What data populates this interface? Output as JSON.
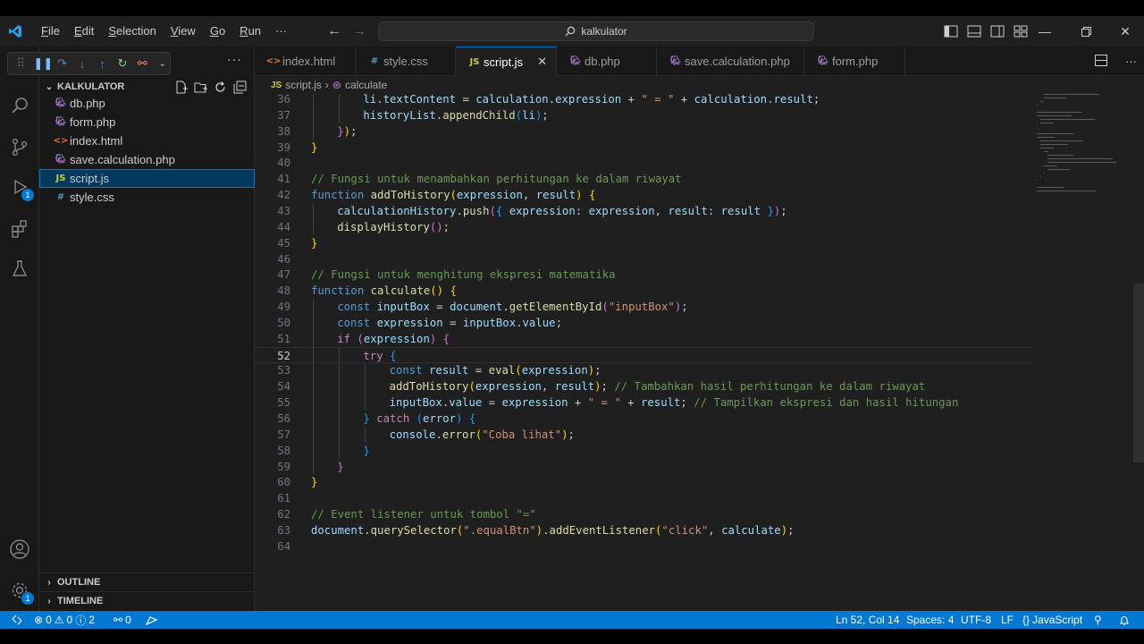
{
  "titlebar": {
    "menu": [
      "File",
      "Edit",
      "Selection",
      "View",
      "Go",
      "Run"
    ],
    "menu_underline": [
      "F",
      "E",
      "S",
      "V",
      "G",
      "R"
    ],
    "menu_rest": [
      "ile",
      "dit",
      "election",
      "iew",
      "o",
      "un"
    ],
    "more": "···",
    "search_text": "kalkulator"
  },
  "explorer": {
    "title": "KALKULATOR",
    "files": [
      {
        "name": "db.php",
        "icon": "php-elephant-icon",
        "active": false
      },
      {
        "name": "form.php",
        "icon": "php-elephant-icon",
        "active": false
      },
      {
        "name": "index.html",
        "icon": "html-icon",
        "active": false
      },
      {
        "name": "save.calculation.php",
        "icon": "php-elephant-icon",
        "active": false
      },
      {
        "name": "script.js",
        "icon": "js-icon",
        "active": true
      },
      {
        "name": "style.css",
        "icon": "css-icon",
        "active": false
      }
    ],
    "outline": "OUTLINE",
    "timeline": "TIMELINE"
  },
  "tabs": [
    {
      "label": "index.html",
      "icon": "html-icon",
      "active": false
    },
    {
      "label": "style.css",
      "icon": "css-icon",
      "active": false
    },
    {
      "label": "script.js",
      "icon": "js-icon",
      "active": true
    },
    {
      "label": "db.php",
      "icon": "php-elephant-icon",
      "active": false
    },
    {
      "label": "save.calculation.php",
      "icon": "php-elephant-icon",
      "active": false
    },
    {
      "label": "form.php",
      "icon": "php-elephant-icon",
      "active": false
    }
  ],
  "breadcrumb": {
    "file": "script.js",
    "symbol": "calculate"
  },
  "editor": {
    "current_line": 52,
    "lines": [
      {
        "n": 36,
        "indent": 2,
        "tokens": [
          [
            "vr",
            "li"
          ],
          [
            "",
            "."
          ],
          [
            "vr",
            "textContent"
          ],
          [
            "",
            " = "
          ],
          [
            "vr",
            "calculation"
          ],
          [
            "",
            "."
          ],
          [
            "vr",
            "expression"
          ],
          [
            "",
            " + "
          ],
          [
            "str",
            "\" = \""
          ],
          [
            "",
            " + "
          ],
          [
            "vr",
            "calculation"
          ],
          [
            "",
            "."
          ],
          [
            "vr",
            "result"
          ],
          [
            "",
            ";"
          ]
        ]
      },
      {
        "n": 37,
        "indent": 2,
        "tokens": [
          [
            "vr",
            "historyList"
          ],
          [
            "",
            "."
          ],
          [
            "fn",
            "appendChild"
          ],
          [
            "b3",
            "("
          ],
          [
            "vr",
            "li"
          ],
          [
            "b3",
            ")"
          ],
          [
            "",
            ";"
          ]
        ]
      },
      {
        "n": 38,
        "indent": 1,
        "tokens": [
          [
            "b2",
            "}"
          ],
          [
            "b1",
            ")"
          ],
          [
            "",
            ";"
          ]
        ]
      },
      {
        "n": 39,
        "indent": 0,
        "tokens": [
          [
            "b1",
            "}"
          ]
        ]
      },
      {
        "n": 40,
        "indent": 0,
        "tokens": []
      },
      {
        "n": 41,
        "indent": 0,
        "tokens": [
          [
            "cm",
            "// Fungsi untuk menambahkan perhitungan ke dalam riwayat"
          ]
        ]
      },
      {
        "n": 42,
        "indent": 0,
        "tokens": [
          [
            "kw",
            "function"
          ],
          [
            "",
            " "
          ],
          [
            "fn",
            "addToHistory"
          ],
          [
            "b1",
            "("
          ],
          [
            "vr",
            "expression"
          ],
          [
            "",
            ", "
          ],
          [
            "vr",
            "result"
          ],
          [
            "b1",
            ")"
          ],
          [
            "",
            " "
          ],
          [
            "b1",
            "{"
          ]
        ]
      },
      {
        "n": 43,
        "indent": 1,
        "tokens": [
          [
            "vr",
            "calculationHistory"
          ],
          [
            "",
            "."
          ],
          [
            "fn",
            "push"
          ],
          [
            "b2",
            "("
          ],
          [
            "b3",
            "{"
          ],
          [
            "",
            " "
          ],
          [
            "vr",
            "expression"
          ],
          [
            "",
            ": "
          ],
          [
            "vr",
            "expression"
          ],
          [
            "",
            ", "
          ],
          [
            "vr",
            "result"
          ],
          [
            "",
            ": "
          ],
          [
            "vr",
            "result"
          ],
          [
            "",
            " "
          ],
          [
            "b3",
            "}"
          ],
          [
            "b2",
            ")"
          ],
          [
            "",
            ";"
          ]
        ]
      },
      {
        "n": 44,
        "indent": 1,
        "tokens": [
          [
            "fn",
            "displayHistory"
          ],
          [
            "b2",
            "()"
          ],
          [
            "",
            ";"
          ]
        ]
      },
      {
        "n": 45,
        "indent": 0,
        "tokens": [
          [
            "b1",
            "}"
          ]
        ]
      },
      {
        "n": 46,
        "indent": 0,
        "tokens": []
      },
      {
        "n": 47,
        "indent": 0,
        "tokens": [
          [
            "cm",
            "// Fungsi untuk menghitung ekspresi matematika"
          ]
        ]
      },
      {
        "n": 48,
        "indent": 0,
        "tokens": [
          [
            "kw",
            "function"
          ],
          [
            "",
            " "
          ],
          [
            "fn",
            "calculate"
          ],
          [
            "b1",
            "()"
          ],
          [
            "",
            " "
          ],
          [
            "b1",
            "{"
          ]
        ]
      },
      {
        "n": 49,
        "indent": 1,
        "tokens": [
          [
            "kw",
            "const"
          ],
          [
            "",
            " "
          ],
          [
            "vr",
            "inputBox"
          ],
          [
            "",
            " = "
          ],
          [
            "vr",
            "document"
          ],
          [
            "",
            "."
          ],
          [
            "fn",
            "getElementById"
          ],
          [
            "b2",
            "("
          ],
          [
            "str",
            "\"inputBox\""
          ],
          [
            "b2",
            ")"
          ],
          [
            "",
            ";"
          ]
        ]
      },
      {
        "n": 50,
        "indent": 1,
        "tokens": [
          [
            "kw",
            "const"
          ],
          [
            "",
            " "
          ],
          [
            "vr",
            "expression"
          ],
          [
            "",
            " = "
          ],
          [
            "vr",
            "inputBox"
          ],
          [
            "",
            "."
          ],
          [
            "vr",
            "value"
          ],
          [
            "",
            ";"
          ]
        ]
      },
      {
        "n": 51,
        "indent": 1,
        "tokens": [
          [
            "kc",
            "if"
          ],
          [
            "",
            " "
          ],
          [
            "b2",
            "("
          ],
          [
            "vr",
            "expression"
          ],
          [
            "b2",
            ")"
          ],
          [
            "",
            " "
          ],
          [
            "b2",
            "{"
          ]
        ]
      },
      {
        "n": 52,
        "indent": 2,
        "tokens": [
          [
            "kc",
            "try"
          ],
          [
            "",
            " "
          ],
          [
            "b3",
            "{"
          ]
        ]
      },
      {
        "n": 53,
        "indent": 3,
        "tokens": [
          [
            "kw",
            "const"
          ],
          [
            "",
            " "
          ],
          [
            "vr",
            "result"
          ],
          [
            "",
            " = "
          ],
          [
            "fn",
            "eval"
          ],
          [
            "b1",
            "("
          ],
          [
            "vr",
            "expression"
          ],
          [
            "b1",
            ")"
          ],
          [
            "",
            ";"
          ]
        ]
      },
      {
        "n": 54,
        "indent": 3,
        "tokens": [
          [
            "fn",
            "addToHistory"
          ],
          [
            "b1",
            "("
          ],
          [
            "vr",
            "expression"
          ],
          [
            "",
            ", "
          ],
          [
            "vr",
            "result"
          ],
          [
            "b1",
            ")"
          ],
          [
            "",
            "; "
          ],
          [
            "cm",
            "// Tambahkan hasil perhitungan ke dalam riwayat"
          ]
        ]
      },
      {
        "n": 55,
        "indent": 3,
        "tokens": [
          [
            "vr",
            "inputBox"
          ],
          [
            "",
            "."
          ],
          [
            "vr",
            "value"
          ],
          [
            "",
            " = "
          ],
          [
            "vr",
            "expression"
          ],
          [
            "",
            " + "
          ],
          [
            "str",
            "\" = \""
          ],
          [
            "",
            " + "
          ],
          [
            "vr",
            "result"
          ],
          [
            "",
            "; "
          ],
          [
            "cm",
            "// Tampilkan ekspresi dan hasil hitungan"
          ]
        ]
      },
      {
        "n": 56,
        "indent": 2,
        "tokens": [
          [
            "b3",
            "}"
          ],
          [
            "",
            " "
          ],
          [
            "kc",
            "catch"
          ],
          [
            "",
            " "
          ],
          [
            "b3",
            "("
          ],
          [
            "vr",
            "error"
          ],
          [
            "b3",
            ")"
          ],
          [
            "",
            " "
          ],
          [
            "b3",
            "{"
          ]
        ]
      },
      {
        "n": 57,
        "indent": 3,
        "tokens": [
          [
            "vr",
            "console"
          ],
          [
            "",
            "."
          ],
          [
            "fn",
            "error"
          ],
          [
            "b1",
            "("
          ],
          [
            "str",
            "\"Coba lihat\""
          ],
          [
            "b1",
            ")"
          ],
          [
            "",
            ";"
          ]
        ]
      },
      {
        "n": 58,
        "indent": 2,
        "tokens": [
          [
            "b3",
            "}"
          ]
        ]
      },
      {
        "n": 59,
        "indent": 1,
        "tokens": [
          [
            "b2",
            "}"
          ]
        ]
      },
      {
        "n": 60,
        "indent": 0,
        "tokens": [
          [
            "b1",
            "}"
          ]
        ]
      },
      {
        "n": 61,
        "indent": 0,
        "tokens": []
      },
      {
        "n": 62,
        "indent": 0,
        "tokens": [
          [
            "cm",
            "// Event listener untuk tombol \"=\""
          ]
        ]
      },
      {
        "n": 63,
        "indent": 0,
        "tokens": [
          [
            "vr",
            "document"
          ],
          [
            "",
            "."
          ],
          [
            "fn",
            "querySelector"
          ],
          [
            "b1",
            "("
          ],
          [
            "str",
            "\".equalBtn\""
          ],
          [
            "b1",
            ")"
          ],
          [
            "",
            "."
          ],
          [
            "fn",
            "addEventListener"
          ],
          [
            "b1",
            "("
          ],
          [
            "str",
            "\"click\""
          ],
          [
            "",
            ", "
          ],
          [
            "vr",
            "calculate"
          ],
          [
            "b1",
            ")"
          ],
          [
            "",
            ";"
          ]
        ]
      },
      {
        "n": 64,
        "indent": 0,
        "tokens": []
      }
    ]
  },
  "statusbar": {
    "errors": "0",
    "warnings": "0",
    "info": "2",
    "ports": "0",
    "position": "Ln 52, Col 14",
    "spaces": "Spaces: 4",
    "encoding": "UTF-8",
    "eol": "LF",
    "language": "JavaScript"
  },
  "badges": {
    "run_debug": "1",
    "settings": "1"
  },
  "colors": {
    "accent": "#0078d4",
    "editor_bg": "#1f1f1f",
    "sidebar_bg": "#181818"
  }
}
